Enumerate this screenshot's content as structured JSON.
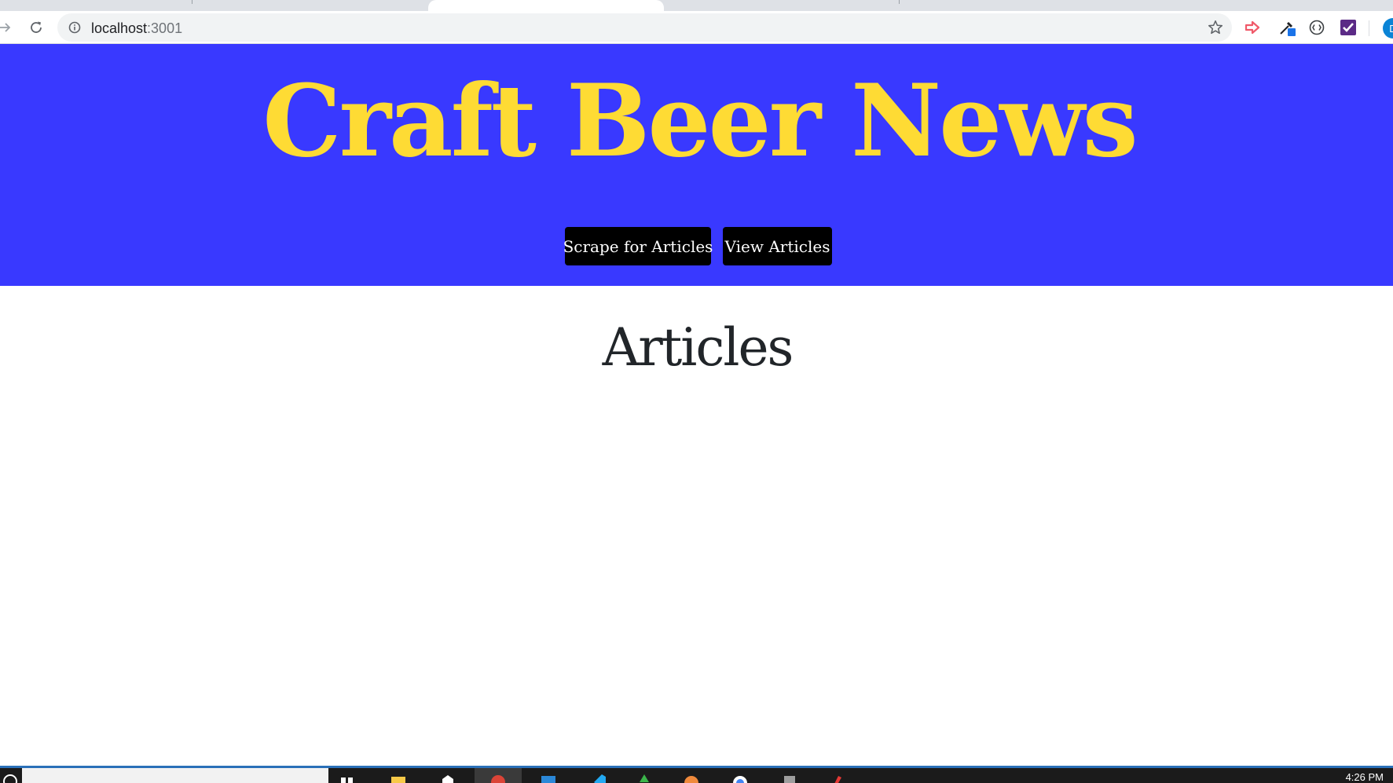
{
  "browser": {
    "url_host": "localhost",
    "url_port": ":3001",
    "profile_initial": "D"
  },
  "page": {
    "site_title": "Craft Beer News",
    "buttons": {
      "scrape": "Scrape for Articles",
      "view": "View Articles"
    },
    "section_title": "Articles"
  },
  "taskbar": {
    "clock": "4:26 PM"
  },
  "colors": {
    "header_background": "#3939ff",
    "title_color": "#fedb34",
    "button_background": "#000000",
    "button_text": "#ffffff",
    "section_title_color": "#212529"
  }
}
